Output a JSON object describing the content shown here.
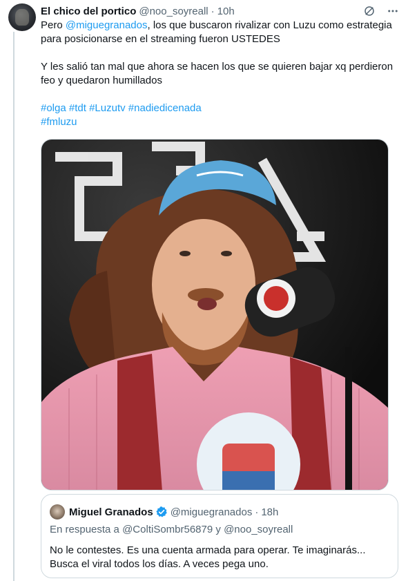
{
  "tweet": {
    "display_name": "El chico del portico",
    "handle": "@noo_soyreall",
    "separator": "·",
    "time": "10h",
    "text": {
      "line1_prefix": "Pero ",
      "mention": "@miguegranados",
      "line1_suffix": ", los que buscaron rivalizar con Luzu como estrategia para posicionarse en el streaming fueron USTEDES",
      "paragraph2": "Y les salió tan mal que ahora se hacen los que se quieren bajar xq perdieron feo y quedaron humillados",
      "hashtags": [
        "#olga",
        "#tdt",
        "#Luzutv",
        "#nadiedicenada",
        "#fmluzu"
      ]
    },
    "icons": {
      "grok": "slash-circle-icon",
      "more": "more-icon"
    }
  },
  "media": {
    "description_icon": "image",
    "colors": {
      "background": "#1a1a1a",
      "cap": "#5aa7d8",
      "shirt": "#e79fb2",
      "hair": "#6b3a22",
      "mic": "#222222"
    }
  },
  "quote": {
    "display_name": "Miguel Granados",
    "handle": "@miguegranados",
    "separator": "·",
    "time": "18h",
    "reply_prefix": "En respuesta a ",
    "reply_user1": "@ColtiSombr56879",
    "reply_joiner": " y ",
    "reply_user2": "@noo_soyreall",
    "text": "No le contestes. Es una cuenta armada para operar. Te imaginarás... Busca el viral todos los días. A veces pega uno."
  },
  "colors": {
    "accent": "#1d9bf0",
    "text": "#0f1419",
    "secondary": "#536471",
    "border": "#cfd9de"
  }
}
